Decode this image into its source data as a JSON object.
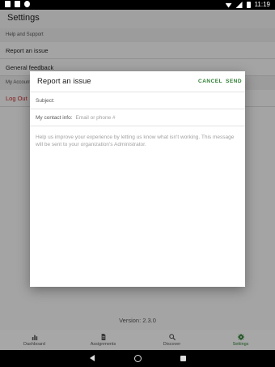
{
  "status_bar": {
    "time": "11:19"
  },
  "app_bar": {
    "title": "Settings"
  },
  "settings": {
    "section_help": "Help and Support",
    "report_issue": "Report an issue",
    "general_feedback": "General feedback",
    "section_account": "My Account",
    "log_out": "Log Out"
  },
  "version": "Version: 2.3.0",
  "bottom_nav": {
    "tabs": [
      {
        "label": "Dashboard",
        "icon": "bar-chart-icon"
      },
      {
        "label": "Assignments",
        "icon": "document-icon"
      },
      {
        "label": "Discover",
        "icon": "search-icon"
      },
      {
        "label": "Settings",
        "icon": "gear-icon",
        "active": true
      }
    ]
  },
  "dialog": {
    "title": "Report an issue",
    "cancel_label": "CANCEL",
    "send_label": "SEND",
    "subject_label": "Subject:",
    "subject_value": "",
    "contact_label": "My contact info:",
    "contact_placeholder": "Email or phone #",
    "message_placeholder": "Help us improve your experience by letting us know what isn't working. This message will be sent to your organization's Administrator."
  },
  "colors": {
    "accent": "#2e7d32",
    "logout": "#c62828"
  }
}
